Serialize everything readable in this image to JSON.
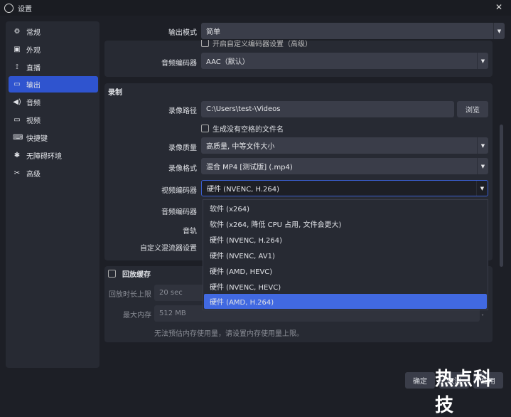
{
  "window": {
    "title": "设置",
    "close": "✕"
  },
  "sidebar": {
    "items": [
      {
        "label": "常规",
        "icon": "⚙"
      },
      {
        "label": "外观",
        "icon": "▣"
      },
      {
        "label": "直播",
        "icon": "⟟"
      },
      {
        "label": "输出",
        "icon": "▭"
      },
      {
        "label": "音频",
        "icon": "◀)"
      },
      {
        "label": "视频",
        "icon": "▭"
      },
      {
        "label": "快捷键",
        "icon": "⌨"
      },
      {
        "label": "无障碍环境",
        "icon": "✱"
      },
      {
        "label": "高级",
        "icon": "✂"
      }
    ]
  },
  "output_mode": {
    "label": "输出模式",
    "value": "简单"
  },
  "streaming": {
    "custom_encoder_checkbox": "开启自定义编码器设置（高级）",
    "audio_encoder_label": "音频编码器",
    "audio_encoder_value": "AAC（默认）"
  },
  "recording": {
    "title": "录制",
    "path_label": "录像路径",
    "path_value": "C:\\Users\\test-\\Videos",
    "browse": "浏览",
    "no_space_checkbox": "生成没有空格的文件名",
    "quality_label": "录像质量",
    "quality_value": "高质量, 中等文件大小",
    "format_label": "录像格式",
    "format_value": "混合 MP4 [测试版] (.mp4)",
    "video_encoder_label": "视频编码器",
    "video_encoder_value": "硬件 (NVENC, H.264)",
    "audio_encoder_label": "音频编码器",
    "audio_track_label": "音轨",
    "muxer_label": "自定义混流器设置"
  },
  "encoder_options": [
    "软件 (x264)",
    "软件 (x264, 降低 CPU 占用, 文件会更大)",
    "硬件 (NVENC, H.264)",
    "硬件 (NVENC, AV1)",
    "硬件 (AMD, HEVC)",
    "硬件 (NVENC, HEVC)",
    "硬件 (AMD, H.264)"
  ],
  "replay": {
    "title": "回放缓存",
    "duration_label": "回放时长上限",
    "duration_value": "20 sec",
    "memory_label": "最大内存",
    "memory_value": "512 MB",
    "note": "无法预估内存使用量，请设置内存使用量上限。"
  },
  "buttons": {
    "ok": "确定",
    "cancel": "取消",
    "apply": "应用"
  },
  "watermark": "热点科技"
}
